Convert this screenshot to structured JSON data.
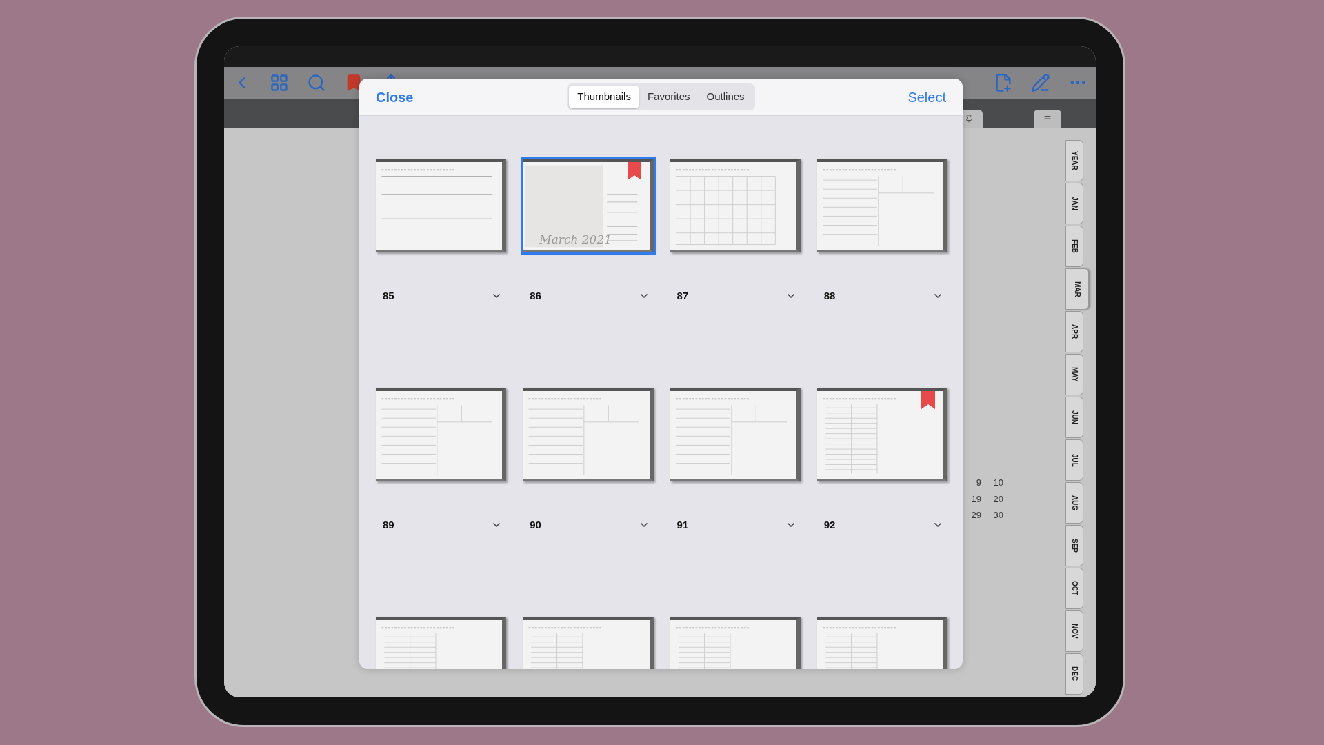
{
  "calendar_fragment": [
    [
      "9",
      "10"
    ],
    [
      "19",
      "20"
    ],
    [
      "29",
      "30"
    ]
  ],
  "month_tabs": [
    {
      "label": "YEAR",
      "selected": false
    },
    {
      "label": "JAN",
      "selected": false
    },
    {
      "label": "FEB",
      "selected": false
    },
    {
      "label": "MAR",
      "selected": true
    },
    {
      "label": "APR",
      "selected": false
    },
    {
      "label": "MAY",
      "selected": false
    },
    {
      "label": "JUN",
      "selected": false
    },
    {
      "label": "JUL",
      "selected": false
    },
    {
      "label": "AUG",
      "selected": false
    },
    {
      "label": "SEP",
      "selected": false
    },
    {
      "label": "OCT",
      "selected": false
    },
    {
      "label": "NOV",
      "selected": false
    },
    {
      "label": "DEC",
      "selected": false
    }
  ],
  "modal": {
    "close": "Close",
    "select": "Select",
    "segments": [
      {
        "label": "Thumbnails",
        "selected": true
      },
      {
        "label": "Favorites",
        "selected": false
      },
      {
        "label": "Outlines",
        "selected": false
      }
    ],
    "thumbnails": [
      {
        "kind": "notes",
        "page": "85",
        "selected": false,
        "bookmarked": false
      },
      {
        "kind": "cover",
        "page": "86",
        "title": "March 2021",
        "selected": true,
        "bookmarked": true
      },
      {
        "kind": "month",
        "page": "87",
        "selected": false,
        "bookmarked": false
      },
      {
        "kind": "day",
        "page": "88",
        "selected": false,
        "bookmarked": false
      },
      {
        "kind": "day",
        "page": "89",
        "selected": false,
        "bookmarked": false
      },
      {
        "kind": "day",
        "page": "90",
        "selected": false,
        "bookmarked": false
      },
      {
        "kind": "day",
        "page": "91",
        "selected": false,
        "bookmarked": false
      },
      {
        "kind": "list",
        "page": "92",
        "selected": false,
        "bookmarked": true
      },
      {
        "kind": "list",
        "selected": false,
        "bookmarked": false
      },
      {
        "kind": "list",
        "selected": false,
        "bookmarked": false
      },
      {
        "kind": "list",
        "selected": false,
        "bookmarked": false
      },
      {
        "kind": "list",
        "selected": false,
        "bookmarked": false
      }
    ]
  }
}
